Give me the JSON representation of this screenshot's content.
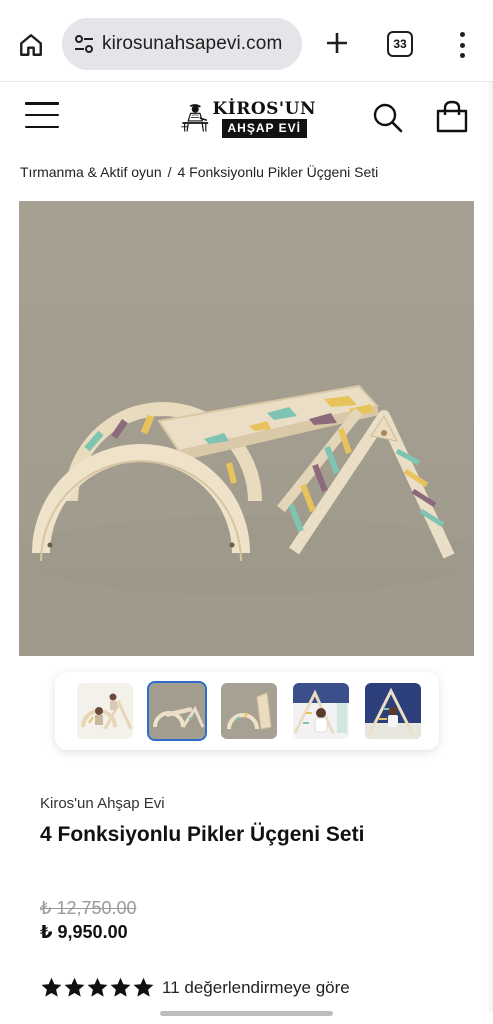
{
  "browser": {
    "url": "kirosunahsapevi.com",
    "tab_count": "33",
    "icons": [
      "home-icon",
      "site-info-icon",
      "new-tab-icon",
      "tab-switcher-icon",
      "overflow-menu-icon"
    ]
  },
  "header": {
    "logo_top": "KİROS'UN",
    "logo_bottom": "AHŞAP EVİ",
    "icons": [
      "hamburger-menu-icon",
      "search-icon",
      "cart-icon"
    ]
  },
  "breadcrumb": {
    "parent": "Tırmanma & Aktif oyun",
    "separator": "/",
    "current": "4 Fonksiyonlu Pikler Üçgeni Seti"
  },
  "product": {
    "vendor": "Kiros'un Ahşap Evi",
    "title": "4 Fonksiyonlu Pikler Üçgeni Seti",
    "price_old": "₺ 12,750.00",
    "price_new": "₺ 9,950.00",
    "rating_stars": 5,
    "rating_text": "11 değerlendirmeye göre"
  },
  "gallery": {
    "thumbnail_count": 5,
    "active_index": 1
  },
  "colors": {
    "wood": "#e9dcc0",
    "backdrop": "#a39d8f",
    "accent_blue": "#2e6ec9",
    "pastel_teal": "#7fc4b2",
    "pastel_yellow": "#e8c25a",
    "pastel_plum": "#8c6a7c"
  }
}
